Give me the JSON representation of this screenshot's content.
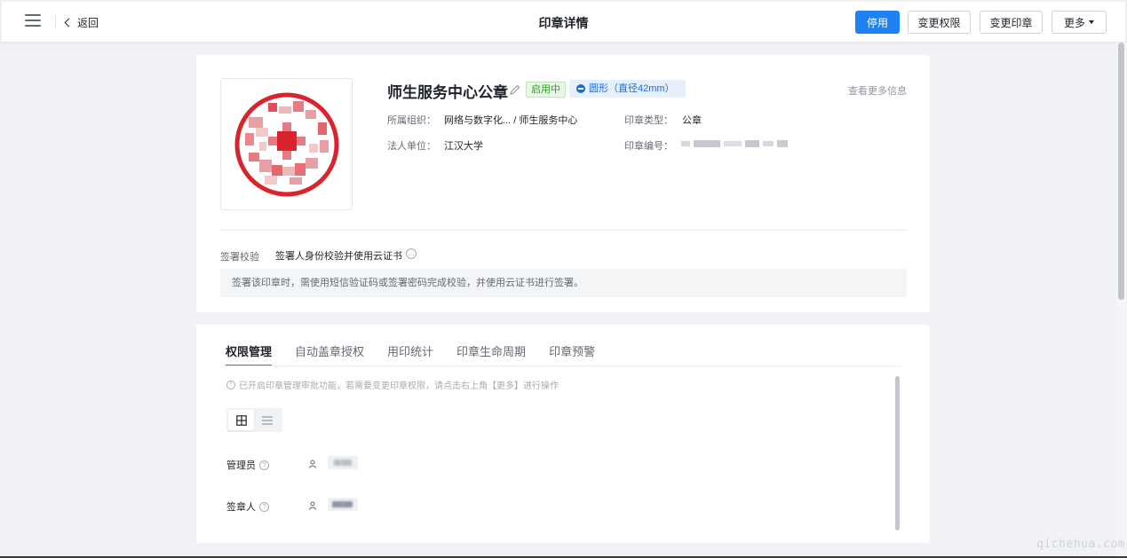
{
  "header": {
    "back_label": "返回",
    "title": "印章详情",
    "buttons": {
      "disable": "停用",
      "change_permission": "变更权限",
      "change_seal": "变更印章",
      "more": "更多"
    }
  },
  "seal": {
    "name": "师生服务中心公章",
    "status": "启用中",
    "shape": "圆形（直径42mm）",
    "more_info": "查看更多信息",
    "org_label": "所属组织：",
    "org_value": "网络与数字化... / 师生服务中心",
    "type_label": "印章类型：",
    "type_value": "公章",
    "legal_label": "法人单位：",
    "legal_value": "江汉大学",
    "code_label": "印章编号："
  },
  "verification": {
    "label": "签署校验",
    "value": "签署人身份校验并使用云证书",
    "description": "签署该印章时，需使用短信验证码或签署密码完成校验，并使用云证书进行签署。"
  },
  "tabs": [
    {
      "label": "权限管理",
      "active": true
    },
    {
      "label": "自动盖章授权",
      "active": false
    },
    {
      "label": "用印统计",
      "active": false
    },
    {
      "label": "印章生命周期",
      "active": false
    },
    {
      "label": "印章预警",
      "active": false
    }
  ],
  "permissions": {
    "notice": "已开启印章管理审批功能，若需要变更印章权限，请点击右上角【更多】进行操作",
    "roles": [
      {
        "label": "管理员"
      },
      {
        "label": "签章人"
      }
    ]
  },
  "watermark": "qichehua.com",
  "colors": {
    "primary": "#1e82f5",
    "seal_red": "#d9232d",
    "status_green": "#2ea121"
  }
}
